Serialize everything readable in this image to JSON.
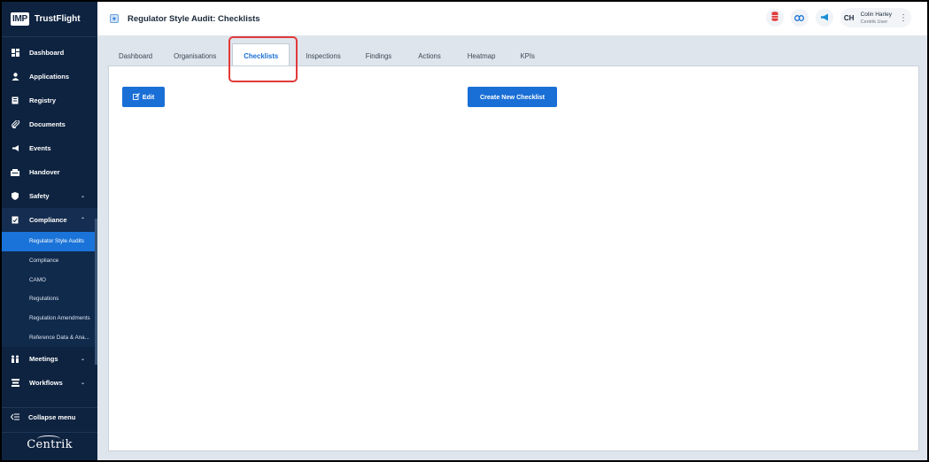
{
  "brand": {
    "logo": "IMP",
    "name": "TrustFlight"
  },
  "sidebar": {
    "items": [
      {
        "label": "Dashboard",
        "icon": "dashboard-icon"
      },
      {
        "label": "Applications",
        "icon": "user-icon"
      },
      {
        "label": "Registry",
        "icon": "registry-icon"
      },
      {
        "label": "Documents",
        "icon": "paperclip-icon"
      },
      {
        "label": "Events",
        "icon": "megaphone-icon"
      },
      {
        "label": "Handover",
        "icon": "handover-icon"
      },
      {
        "label": "Safety",
        "icon": "shield-icon",
        "chevron": "⌄"
      },
      {
        "label": "Compliance",
        "icon": "compliance-icon",
        "chevron": "⌃"
      }
    ],
    "compliance_sub": [
      {
        "label": "Regulator Style Audits",
        "active": true
      },
      {
        "label": "Compliance"
      },
      {
        "label": "CAMO"
      },
      {
        "label": "Regulations"
      },
      {
        "label": "Regulation Amendments"
      },
      {
        "label": "Reference Data & Ana..."
      }
    ],
    "items_after": [
      {
        "label": "Meetings",
        "icon": "meetings-icon",
        "chevron": "⌄"
      },
      {
        "label": "Workflows",
        "icon": "workflows-icon",
        "chevron": "⌄"
      }
    ],
    "collapse_label": "Collapse menu",
    "footer_logo": "Centrik"
  },
  "header": {
    "title": "Regulator Style Audit: Checklists",
    "user": {
      "initials": "CH",
      "name": "Colin Harley",
      "role": "Centrik User"
    }
  },
  "tabs": [
    {
      "label": "Dashboard"
    },
    {
      "label": "Organisations"
    },
    {
      "label": "Checklists",
      "active": true
    },
    {
      "label": "Inspections"
    },
    {
      "label": "Findings"
    },
    {
      "label": "Actions"
    },
    {
      "label": "Heatmap"
    },
    {
      "label": "KPIs"
    }
  ],
  "content": {
    "edit_label": "Edit",
    "create_label": "Create New Checklist"
  },
  "colors": {
    "sidebar_bg": "#0e2340",
    "accent": "#1a6fd6",
    "highlight": "#e13a3a"
  }
}
